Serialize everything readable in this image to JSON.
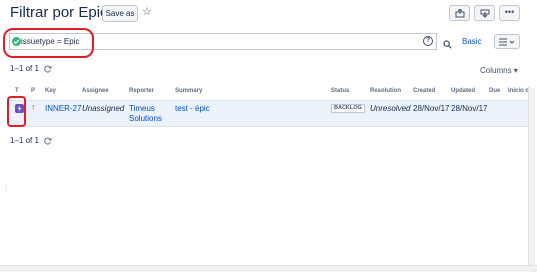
{
  "header": {
    "title": "Filtrar por Epics",
    "save_as_label": "Save as",
    "star_glyph": "☆",
    "more_glyph": "•••"
  },
  "search": {
    "query": "issuetype = Epic",
    "help_glyph": "?",
    "basic_label": "Basic"
  },
  "results": {
    "count_top": "1–1 of 1",
    "count_bottom": "1–1 of 1",
    "columns_label": "Columns ▾"
  },
  "table": {
    "headers": {
      "type": "T",
      "priority": "P",
      "key": "Key",
      "assignee": "Assignee",
      "reporter": "Reporter",
      "summary": "Summary",
      "status": "Status",
      "resolution": "Resolution",
      "created": "Created",
      "updated": "Updated",
      "due": "Due",
      "inicio": "Inicio d"
    },
    "rows": [
      {
        "priority_glyph": "↑",
        "key": "INNER-27",
        "assignee": "Unassigned",
        "reporter_line1": "Timeus",
        "reporter_line2": "Solutions",
        "summary": "test - épic",
        "status": "BACKLOG",
        "resolution": "Unresolved",
        "created": "28/Nov/17",
        "updated": "28/Nov/17"
      }
    ]
  },
  "colors": {
    "accent": "#0052cc",
    "highlight": "#e31e24",
    "epic": "#6554c0",
    "success": "#36b37e",
    "row_selected": "#ebf2f9"
  },
  "icons": [
    "star-icon",
    "share-icon",
    "export-icon",
    "more-icon",
    "check-circle-icon",
    "help-icon",
    "search-icon",
    "list-view-icon",
    "refresh-icon",
    "epic-icon",
    "priority-up-icon"
  ]
}
